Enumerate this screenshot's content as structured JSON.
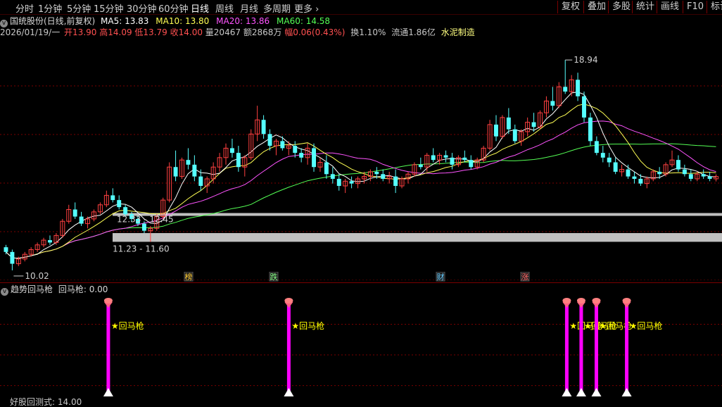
{
  "tabs": [
    "分时",
    "1分钟",
    "5分钟",
    "15分钟",
    "30分钟",
    "60分钟",
    "日线",
    "周线",
    "月线",
    "多周期",
    "更多"
  ],
  "active_tab": "日线",
  "right_buttons": [
    "复权",
    "叠加",
    "多股",
    "统计",
    "画线",
    "F10",
    "标记"
  ],
  "header": {
    "stock_name": "国统股份(日线,前复权)",
    "ma5": "MA5: 13.83",
    "ma10": "MA10: 13.80",
    "ma20": "MA20: 13.86",
    "ma60": "MA60: 14.58",
    "date": "2026/01/19/一",
    "open": "开13.90",
    "high": "高14.09",
    "low": "低13.79",
    "close": "收14.00",
    "volume": "量20467",
    "amount": "额2868万",
    "change": "幅0.06(0.43%)",
    "turnover": "换1.10%",
    "float_cap": "流通1.86亿",
    "industry": "水泥制造"
  },
  "annotations": {
    "high_label": "18.94",
    "low_label": "10.02",
    "zone1": "12.33 - 12.45",
    "zone2": "11.23 - 11.60"
  },
  "markers": [
    "榜",
    "跌",
    "财",
    "涨"
  ],
  "indicator": {
    "title": "趋势回马枪",
    "value": "回马枪: 0.00",
    "signal_label": "★回马枪"
  },
  "bottom_label": "好股回测式: 14.00",
  "colors": {
    "up": "#ff4040",
    "down": "#55ffff",
    "ma5": "#ffffff",
    "ma10": "#ffff54",
    "ma20": "#ff54ff",
    "ma60": "#54ff54",
    "signal": "#ff00ff",
    "zone": "#c0c0c0",
    "grid": "#7a0000"
  },
  "candles": [
    [
      11.0,
      11.1,
      10.7,
      10.8
    ],
    [
      10.8,
      10.9,
      10.02,
      10.3
    ],
    [
      10.3,
      10.6,
      10.2,
      10.5
    ],
    [
      10.5,
      10.8,
      10.4,
      10.7
    ],
    [
      10.7,
      11.0,
      10.6,
      10.9
    ],
    [
      10.9,
      11.2,
      10.8,
      11.1
    ],
    [
      11.1,
      11.4,
      11.0,
      11.3
    ],
    [
      11.3,
      11.5,
      11.1,
      11.2
    ],
    [
      11.2,
      11.6,
      11.1,
      11.5
    ],
    [
      11.5,
      12.2,
      11.4,
      12.1
    ],
    [
      12.1,
      12.8,
      12.0,
      12.6
    ],
    [
      12.6,
      12.9,
      12.2,
      12.3
    ],
    [
      12.3,
      12.5,
      11.9,
      12.0
    ],
    [
      12.0,
      12.3,
      11.8,
      12.2
    ],
    [
      12.2,
      12.6,
      12.1,
      12.5
    ],
    [
      12.5,
      12.9,
      12.4,
      12.8
    ],
    [
      12.8,
      13.4,
      12.7,
      13.2
    ],
    [
      13.2,
      13.5,
      12.9,
      13.0
    ],
    [
      13.0,
      13.2,
      12.6,
      12.7
    ],
    [
      12.7,
      12.8,
      12.3,
      12.4
    ],
    [
      12.4,
      12.5,
      12.1,
      12.2
    ],
    [
      12.2,
      12.3,
      11.9,
      12.0
    ],
    [
      12.0,
      12.1,
      11.6,
      11.7
    ],
    [
      11.7,
      11.9,
      11.23,
      11.8
    ],
    [
      11.8,
      12.4,
      11.7,
      12.3
    ],
    [
      12.3,
      13.1,
      12.2,
      13.0
    ],
    [
      13.0,
      14.6,
      12.9,
      14.4
    ],
    [
      14.4,
      15.1,
      13.8,
      14.0
    ],
    [
      14.0,
      14.8,
      13.9,
      14.7
    ],
    [
      14.7,
      15.2,
      14.3,
      14.5
    ],
    [
      14.5,
      14.9,
      13.8,
      14.0
    ],
    [
      14.0,
      14.3,
      13.4,
      13.6
    ],
    [
      13.6,
      14.0,
      13.3,
      13.9
    ],
    [
      13.9,
      14.6,
      13.7,
      14.4
    ],
    [
      14.4,
      15.0,
      14.2,
      14.8
    ],
    [
      14.8,
      15.4,
      14.5,
      15.2
    ],
    [
      15.2,
      15.6,
      14.8,
      15.0
    ],
    [
      15.0,
      15.3,
      14.2,
      14.4
    ],
    [
      14.4,
      14.9,
      14.0,
      14.8
    ],
    [
      14.8,
      16.0,
      14.7,
      15.8
    ],
    [
      15.8,
      17.0,
      15.5,
      16.4
    ],
    [
      16.4,
      16.6,
      15.6,
      15.8
    ],
    [
      15.8,
      16.0,
      15.1,
      15.3
    ],
    [
      15.3,
      15.6,
      14.9,
      15.5
    ],
    [
      15.5,
      15.7,
      15.1,
      15.2
    ],
    [
      15.2,
      15.5,
      14.9,
      15.3
    ],
    [
      15.3,
      15.5,
      14.8,
      15.0
    ],
    [
      15.0,
      15.2,
      14.6,
      14.8
    ],
    [
      14.8,
      15.4,
      14.5,
      15.2
    ],
    [
      15.2,
      15.4,
      14.2,
      14.4
    ],
    [
      14.4,
      14.8,
      14.2,
      14.6
    ],
    [
      14.6,
      14.9,
      13.9,
      14.1
    ],
    [
      14.1,
      14.4,
      13.7,
      13.9
    ],
    [
      13.9,
      14.1,
      13.4,
      13.6
    ],
    [
      13.6,
      13.9,
      13.3,
      13.8
    ],
    [
      13.8,
      14.0,
      13.5,
      13.7
    ],
    [
      13.7,
      14.0,
      13.5,
      13.9
    ],
    [
      13.9,
      14.2,
      13.7,
      14.0
    ],
    [
      14.0,
      14.3,
      13.8,
      14.2
    ],
    [
      14.2,
      14.4,
      13.9,
      14.1
    ],
    [
      14.1,
      14.3,
      13.8,
      13.9
    ],
    [
      13.9,
      14.2,
      13.7,
      14.0
    ],
    [
      14.0,
      14.3,
      13.3,
      13.6
    ],
    [
      13.6,
      14.0,
      13.5,
      13.9
    ],
    [
      13.9,
      14.2,
      13.7,
      14.1
    ],
    [
      14.1,
      14.6,
      14.0,
      14.5
    ],
    [
      14.5,
      14.8,
      14.3,
      14.4
    ],
    [
      14.4,
      15.0,
      14.2,
      14.9
    ],
    [
      14.9,
      15.2,
      14.6,
      14.7
    ],
    [
      14.7,
      15.0,
      14.5,
      14.9
    ],
    [
      14.9,
      15.1,
      14.6,
      14.8
    ],
    [
      14.8,
      15.0,
      14.3,
      14.5
    ],
    [
      14.5,
      14.9,
      14.4,
      14.8
    ],
    [
      14.8,
      15.1,
      14.6,
      14.7
    ],
    [
      14.7,
      14.9,
      14.3,
      14.4
    ],
    [
      14.4,
      14.8,
      14.3,
      14.7
    ],
    [
      14.7,
      15.3,
      14.6,
      15.2
    ],
    [
      15.2,
      16.4,
      15.1,
      16.2
    ],
    [
      16.2,
      16.6,
      15.5,
      15.7
    ],
    [
      15.7,
      16.6,
      15.6,
      16.5
    ],
    [
      16.5,
      16.9,
      15.8,
      16.0
    ],
    [
      16.0,
      16.2,
      15.4,
      15.5
    ],
    [
      15.5,
      16.0,
      15.3,
      15.9
    ],
    [
      15.9,
      16.5,
      15.7,
      16.3
    ],
    [
      16.3,
      16.7,
      15.9,
      16.1
    ],
    [
      16.1,
      16.8,
      16.0,
      16.7
    ],
    [
      16.7,
      17.4,
      16.5,
      17.2
    ],
    [
      17.2,
      17.8,
      16.8,
      17.0
    ],
    [
      17.0,
      18.0,
      16.9,
      17.8
    ],
    [
      17.8,
      18.94,
      17.5,
      17.6
    ],
    [
      17.6,
      18.3,
      17.4,
      18.1
    ],
    [
      18.1,
      18.4,
      17.2,
      17.4
    ],
    [
      17.4,
      17.6,
      16.3,
      16.5
    ],
    [
      16.5,
      16.7,
      15.3,
      15.5
    ],
    [
      15.5,
      15.7,
      14.9,
      15.0
    ],
    [
      15.0,
      15.3,
      14.6,
      14.8
    ],
    [
      14.8,
      15.0,
      14.4,
      14.6
    ],
    [
      14.6,
      14.8,
      14.1,
      14.2
    ],
    [
      14.2,
      14.5,
      14.0,
      14.3
    ],
    [
      14.3,
      14.5,
      13.9,
      14.0
    ],
    [
      14.0,
      14.2,
      13.7,
      13.9
    ],
    [
      13.9,
      14.1,
      13.6,
      13.7
    ],
    [
      13.7,
      14.0,
      13.5,
      13.9
    ],
    [
      13.9,
      14.3,
      13.8,
      14.2
    ],
    [
      14.2,
      14.4,
      13.9,
      14.1
    ],
    [
      14.1,
      14.6,
      14.0,
      14.5
    ],
    [
      14.5,
      15.1,
      14.4,
      14.7
    ],
    [
      14.7,
      14.9,
      14.2,
      14.3
    ],
    [
      14.3,
      14.5,
      14.0,
      14.1
    ],
    [
      14.1,
      14.3,
      13.8,
      13.9
    ],
    [
      13.9,
      14.2,
      13.8,
      14.1
    ],
    [
      14.1,
      14.3,
      13.9,
      14.0
    ],
    [
      14.0,
      14.2,
      13.8,
      13.9
    ],
    [
      13.9,
      14.09,
      13.79,
      14.0
    ]
  ],
  "signals": [
    0.15,
    0.4,
    0.785,
    0.805,
    0.826,
    0.868
  ]
}
